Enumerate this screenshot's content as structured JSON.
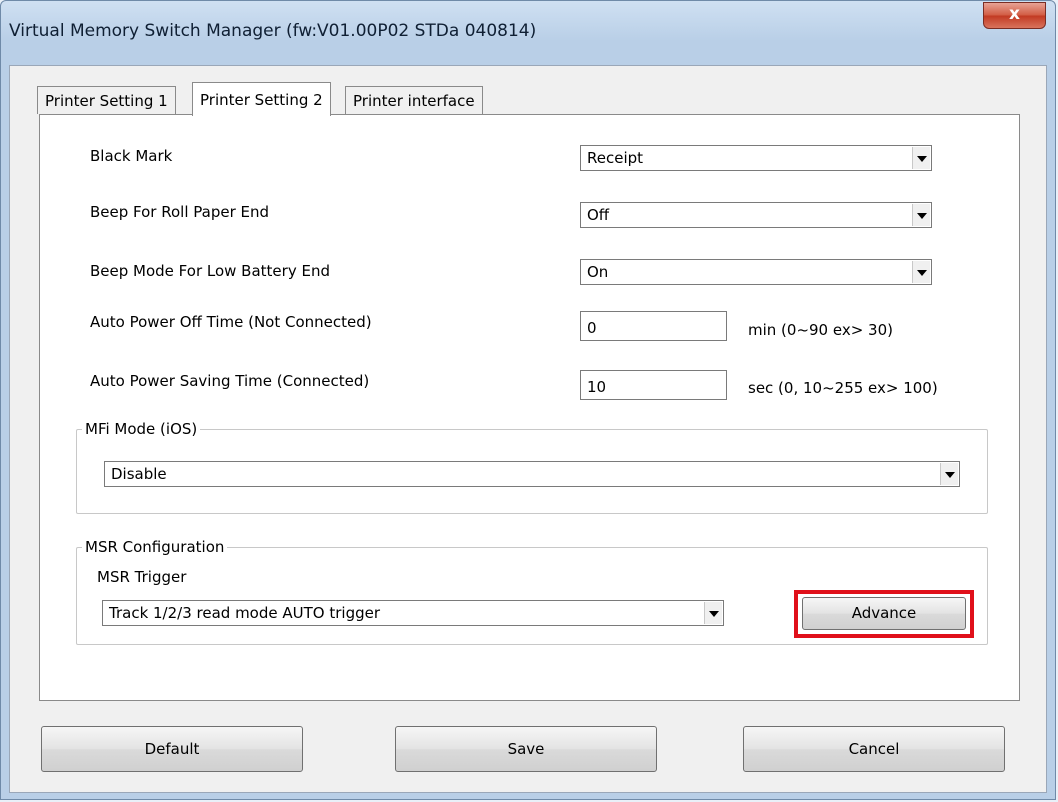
{
  "window": {
    "title": "Virtual Memory Switch Manager  (fw:V01.00P02 STDa 040814)",
    "close_label": "x"
  },
  "tabs": [
    {
      "label": "Printer Setting 1",
      "active": false
    },
    {
      "label": "Printer Setting 2",
      "active": true
    },
    {
      "label": "Printer interface",
      "active": false
    }
  ],
  "settings": {
    "black_mark": {
      "label": "Black Mark",
      "value": "Receipt"
    },
    "beep_roll_paper_end": {
      "label": "Beep For Roll Paper End",
      "value": "Off"
    },
    "beep_low_battery": {
      "label": "Beep Mode For Low Battery End",
      "value": "On"
    },
    "auto_power_off": {
      "label": "Auto Power Off Time (Not Connected)",
      "value": "0",
      "hint": "min (0~90 ex> 30)"
    },
    "auto_power_saving": {
      "label": "Auto Power Saving Time (Connected)",
      "value": "10",
      "hint": "sec (0, 10~255 ex> 100)"
    }
  },
  "mfi": {
    "legend": "MFi Mode (iOS)",
    "value": "Disable"
  },
  "msr": {
    "legend": "MSR Configuration",
    "trigger_label": "MSR Trigger",
    "trigger_value": "Track 1/2/3 read mode AUTO trigger",
    "advance_label": "Advance"
  },
  "buttons": {
    "default_label": "Default",
    "save_label": "Save",
    "cancel_label": "Cancel"
  },
  "colors": {
    "highlight": "#e0101a",
    "close_button": "#c23a23"
  }
}
